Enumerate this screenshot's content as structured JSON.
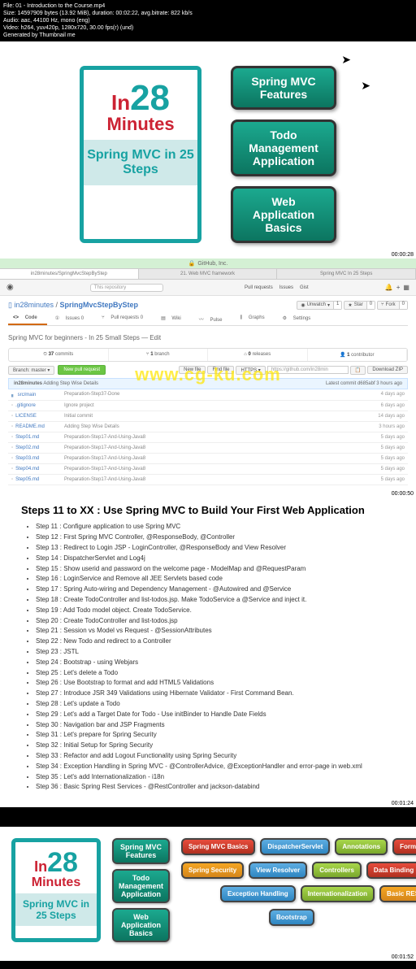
{
  "meta": {
    "line1": "File: 01 - Introduction to the Course.mp4",
    "line2": "Size: 14597909 bytes (13.92 MiB), duration: 00:02:22, avg.bitrate: 822 kb/s",
    "line3": "Audio: aac, 44100 Hz, mono (eng)",
    "line4": "Video: h264, yuv420p, 1280x720, 30.00 fps(r) (und)",
    "line5": "Generated by Thumbnail me"
  },
  "logo": {
    "in": "In",
    "n28": "28",
    "minutes": "Minutes",
    "sub": "Spring MVC in 25 Steps"
  },
  "slide1": {
    "b1": "Spring MVC Features",
    "b2": "Todo Management Application",
    "b3": "Web Application Basics"
  },
  "time1": "00:00:28",
  "time2": "00:00:50",
  "time3": "00:01:24",
  "time4": "00:01:52",
  "gh": {
    "host": "GitHub, Inc.",
    "tabs": [
      "in28minutes/SpringMvcStepByStep",
      "21. Web MVC framework",
      "Spring MVC In 25 Steps"
    ],
    "searchPlaceholder": "This repository",
    "topnav": [
      "Pull requests",
      "Issues",
      "Gist"
    ],
    "owner": "in28minutes",
    "repo": "SpringMvcStepByStep",
    "watch": {
      "label": "Unwatch",
      "count": "1"
    },
    "star": {
      "label": "Star",
      "count": "0"
    },
    "fork": {
      "label": "Fork",
      "count": "0"
    },
    "nav": [
      "Code",
      "Issues 0",
      "Pull requests 0",
      "Wiki",
      "Pulse",
      "Graphs",
      "Settings"
    ],
    "desc": "Spring MVC for beginners - In 25 Small Steps — Edit",
    "stats": [
      {
        "n": "37",
        "l": "commits"
      },
      {
        "n": "1",
        "l": "branch"
      },
      {
        "n": "0",
        "l": "releases"
      },
      {
        "n": "1",
        "l": "contributor"
      }
    ],
    "branch": "Branch: master",
    "newpr": "New pull request",
    "newfile": "New file",
    "findfile": "Find file",
    "https": "HTTPS",
    "cloneurl": "https://github.com/in28min",
    "dlzip": "Download ZIP",
    "commitmsg_user": "in28minutes",
    "commitmsg": "Adding Step Wise Details",
    "commithash": "Latest commit d685abf 3 hours ago",
    "files": [
      {
        "t": "d",
        "name": "src/main",
        "msg": "Preparation-Step37-Done",
        "time": "4 days ago"
      },
      {
        "t": "f",
        "name": ".gitignore",
        "msg": "Ignore project",
        "time": "6 days ago"
      },
      {
        "t": "f",
        "name": "LICENSE",
        "msg": "Initial commit",
        "time": "14 days ago"
      },
      {
        "t": "f",
        "name": "README.md",
        "msg": "Adding Step Wise Details",
        "time": "3 hours ago"
      },
      {
        "t": "f",
        "name": "Step01.md",
        "msg": "Preparation-Step17-And-Using-Java8",
        "time": "5 days ago"
      },
      {
        "t": "f",
        "name": "Step02.md",
        "msg": "Preparation-Step17-And-Using-Java8",
        "time": "5 days ago"
      },
      {
        "t": "f",
        "name": "Step03.md",
        "msg": "Preparation-Step17-And-Using-Java8",
        "time": "5 days ago"
      },
      {
        "t": "f",
        "name": "Step04.md",
        "msg": "Preparation-Step17-And-Using-Java8",
        "time": "5 days ago"
      },
      {
        "t": "f",
        "name": "Step05.md",
        "msg": "Preparation-Step17-And-Using-Java8",
        "time": "5 days ago"
      }
    ]
  },
  "watermark": "www.cg-ku.com",
  "steps": {
    "title": "Steps 11 to XX : Use Spring MVC to Build Your First Web Application",
    "items": [
      "Step 11 : Configure application to use Spring MVC",
      "Step 12 : First Spring MVC Controller, @ResponseBody, @Controller",
      "Step 13 : Redirect to Login JSP - LoginController, @ResponseBody and View Resolver",
      "Step 14 : DispatcherServlet and Log4j",
      "Step 15 : Show userid and password on the welcome page - ModelMap and @RequestParam",
      "Step 16 : LoginService and Remove all JEE Servlets based code",
      "Step 17 : Spring Auto-wiring and Dependency Management - @Autowired and @Service",
      "Step 18 : Create TodoController and list-todos.jsp. Make TodoService a @Service and inject it.",
      "Step 19 : Add Todo model object. Create TodoService.",
      "Step 20 : Create TodoController and list-todos.jsp",
      "Step 21 : Session vs Model vs Request - @SessionAttributes",
      "Step 22 : New Todo and redirect to a Controller",
      "Step 23 : JSTL",
      "Step 24 : Bootstrap - using Webjars",
      "Step 25 : Let's delete a Todo",
      "Step 26 : Use Bootstrap to format and add HTML5 Validations",
      "Step 27 : Introduce JSR 349 Validations using Hibernate Validator - First Command Bean.",
      "Step 28 : Let's update a Todo",
      "Step 29 : Let's add a Target Date for Todo - Use initBinder to Handle Date Fields",
      "Step 30 : Navigation bar and JSP Fragments",
      "Step 31 : Let's prepare for Spring Security",
      "Step 32 : Initial Setup for Spring Security",
      "Step 33 : Refactor and add Logout Functionality using Spring Security",
      "Step 34 : Exception Handling in Spring MVC - @ControllerAdvice, @ExceptionHandler and error-page in web.xml",
      "Step 35 : Let's add Internationalization - i18n",
      "Step 36 : Basic Spring Rest Services - @RestController and jackson-databind"
    ]
  },
  "slide3": {
    "leftcol": [
      "Spring MVC Features",
      "Todo Management Application",
      "Web Application Basics"
    ],
    "row1": [
      "Spring MVC Basics",
      "DispatcherServlet",
      "Annotations",
      "Forms"
    ],
    "row2": [
      "Spring Security",
      "View Resolver",
      "Controllers",
      "Data Binding"
    ],
    "row3": [
      "Exception Handling",
      "Internationalization",
      "Basic REST"
    ],
    "row4": [
      "Bootstrap"
    ]
  }
}
